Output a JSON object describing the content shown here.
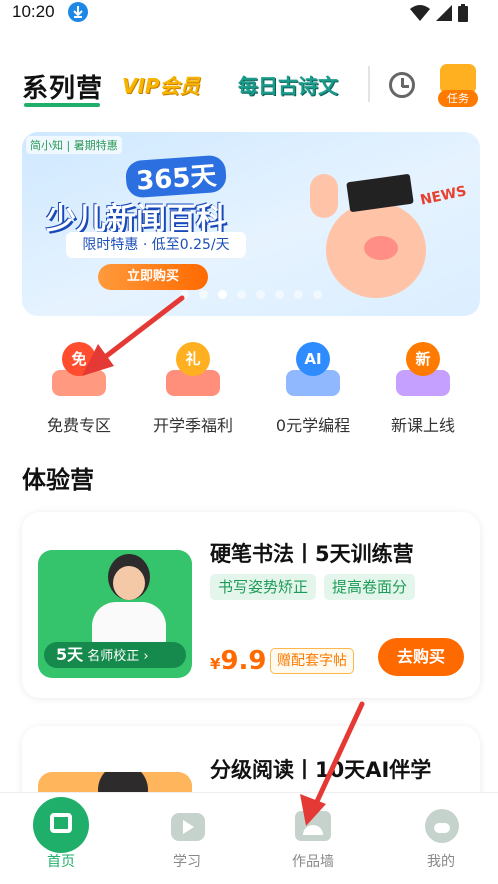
{
  "status_bar": {
    "time": "10:20"
  },
  "header": {
    "tab_series": "系列营",
    "tab_vip": "VIP会员",
    "tab_poem": "每日古诗文",
    "task_label": "任务"
  },
  "banner": {
    "brand": "简小知 | 暑期特惠",
    "days": "365天",
    "title": "少儿新闻百科",
    "subtitle": "限时特惠 · 低至0.25/天",
    "button": "立即购买",
    "news_tag": "NEWS"
  },
  "categories": [
    {
      "label": "免费专区",
      "badge": "免",
      "color": "#ff4d2e"
    },
    {
      "label": "开学季福利",
      "badge": "礼",
      "color": "#ff7a3d"
    },
    {
      "label": "0元学编程",
      "badge": "AI",
      "color": "#2f8cff"
    },
    {
      "label": "新课上线",
      "badge": "新",
      "color": "#ff7a00"
    }
  ],
  "section": {
    "title": "体验营"
  },
  "courses": [
    {
      "title": "硬笔书法丨5天训练营",
      "tags": [
        "书写姿势矫正",
        "提高卷面分"
      ],
      "thumb_days": "5天",
      "thumb_text": "名师校正 ›",
      "price_symbol": "¥",
      "price": "9.9",
      "gift": "赠配套字帖",
      "buy": "去购买"
    },
    {
      "title": "分级阅读丨10天AI伴学"
    }
  ],
  "bottom_nav": [
    {
      "label": "首页",
      "icon": "home-icon"
    },
    {
      "label": "学习",
      "icon": "tv-icon"
    },
    {
      "label": "作品墙",
      "icon": "gallery-icon"
    },
    {
      "label": "我的",
      "icon": "profile-icon"
    }
  ],
  "colors": {
    "brand_green": "#1faf6a",
    "accent_orange": "#ff6a00"
  }
}
